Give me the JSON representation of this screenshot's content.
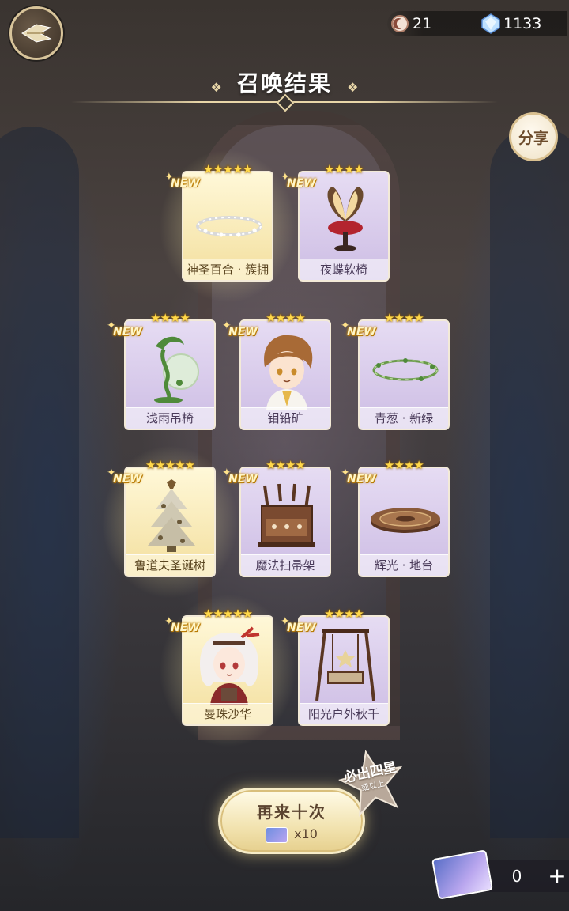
{
  "header": {
    "title": "召唤结果",
    "title_deco_left": "❖",
    "title_deco_right": "❖",
    "share_label": "分享"
  },
  "currency": [
    {
      "icon": "moon-coin-icon",
      "value": "21"
    },
    {
      "icon": "diamond-icon",
      "value": "1133"
    }
  ],
  "cards": [
    {
      "name": "神圣百合 · 簇拥",
      "stars": "★★★★★",
      "badge": "NEW",
      "rarity": "gold",
      "art": "halo-icon"
    },
    {
      "name": "夜蝶软椅",
      "stars": "★★★★",
      "badge": "NEW",
      "rarity": "purple",
      "art": "butterfly-chair-icon"
    },
    {
      "name": "浅雨吊椅",
      "stars": "★★★★",
      "badge": "NEW",
      "rarity": "purple",
      "art": "hanging-chair-icon"
    },
    {
      "name": "钼铅矿",
      "stars": "★★★★",
      "badge": "NEW",
      "rarity": "purple",
      "art": "boy-character-icon"
    },
    {
      "name": "青葱 · 新绿",
      "stars": "★★★★",
      "badge": "NEW",
      "rarity": "purple",
      "art": "vine-halo-icon"
    },
    {
      "name": "鲁道夫圣诞树",
      "stars": "★★★★★",
      "badge": "NEW",
      "rarity": "gold",
      "art": "christmas-tree-icon"
    },
    {
      "name": "魔法扫帚架",
      "stars": "★★★★",
      "badge": "NEW",
      "rarity": "purple",
      "art": "broom-rack-icon"
    },
    {
      "name": "辉光 · 地台",
      "stars": "★★★★",
      "badge": "NEW",
      "rarity": "purple",
      "art": "platform-icon"
    },
    {
      "name": "曼珠沙华",
      "stars": "★★★★★",
      "badge": "NEW",
      "rarity": "gold",
      "art": "girl-character-icon"
    },
    {
      "name": "阳光户外秋千",
      "stars": "★★★★",
      "badge": "NEW",
      "rarity": "purple",
      "art": "swing-icon"
    }
  ],
  "bottom": {
    "again_label": "再来十次",
    "again_cost": "x10",
    "guarantee_main": "必出四星",
    "guarantee_sub": "或以上",
    "ticket_count": "0",
    "ticket_plus": "+"
  }
}
